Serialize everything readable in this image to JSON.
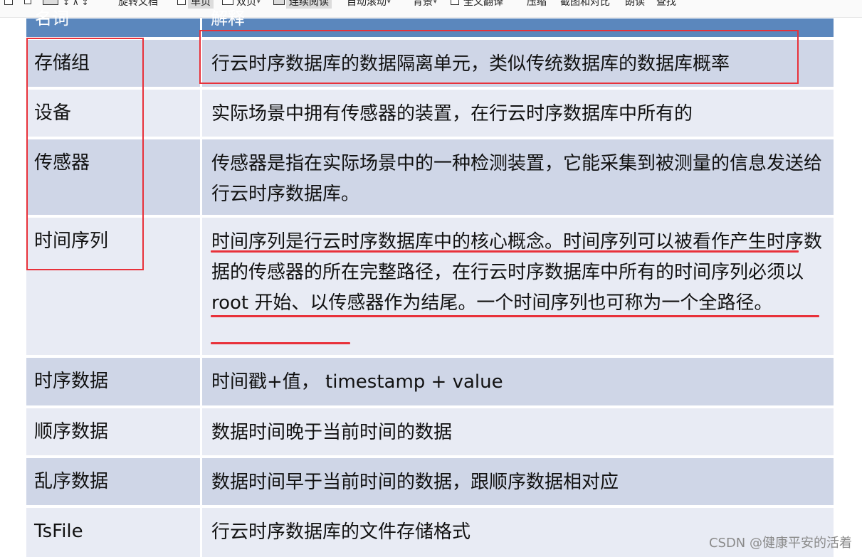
{
  "toolbar": {
    "items": [
      {
        "label": "旋转文档"
      },
      {
        "label": "单页"
      },
      {
        "label": "双页"
      },
      {
        "label": "连续阅读"
      },
      {
        "label": "自动滚动"
      },
      {
        "label": "背景"
      },
      {
        "label": "全文翻译"
      },
      {
        "label": "压缩"
      },
      {
        "label": "截图和对比"
      },
      {
        "label": "朗读"
      },
      {
        "label": "查找"
      }
    ]
  },
  "table": {
    "header": [
      "名词",
      "解释"
    ],
    "rows": [
      {
        "term": "存储组",
        "desc": "行云时序数据库的数据隔离单元，类似传统数据库的数据库概率"
      },
      {
        "term": "设备",
        "desc": "实际场景中拥有传感器的装置，在行云时序数据库中所有的"
      },
      {
        "term": "传感器",
        "desc": "传感器是指在实际场景中的一种检测装置，它能采集到被测量的信息发送给行云时序数据库。"
      },
      {
        "term": "时间序列",
        "desc": "时间序列是行云时序数据库中的核心概念。时间序列可以被看作产生时序数据的传感器的所在完整路径，在行云时序数据库中所有的时间序列必须以 root 开始、以传感器作为结尾。一个时间序列也可称为一个全路径。"
      },
      {
        "term": "时序数据",
        "desc": "时间戳+值， timestamp + value"
      },
      {
        "term": "顺序数据",
        "desc": "数据时间晚于当前时间的数据"
      },
      {
        "term": "乱序数据",
        "desc": "数据时间早于当前时间的数据，跟顺序数据相对应"
      },
      {
        "term": "TsFile",
        "desc": "行云时序数据库的文件存储格式"
      }
    ]
  },
  "annotation_color": "#e8313a",
  "header_color": "#5b87bd",
  "row_colors": {
    "dark": "#cfd6e7",
    "light": "#e8ebf4"
  },
  "watermark": "CSDN @健康平安的活着"
}
